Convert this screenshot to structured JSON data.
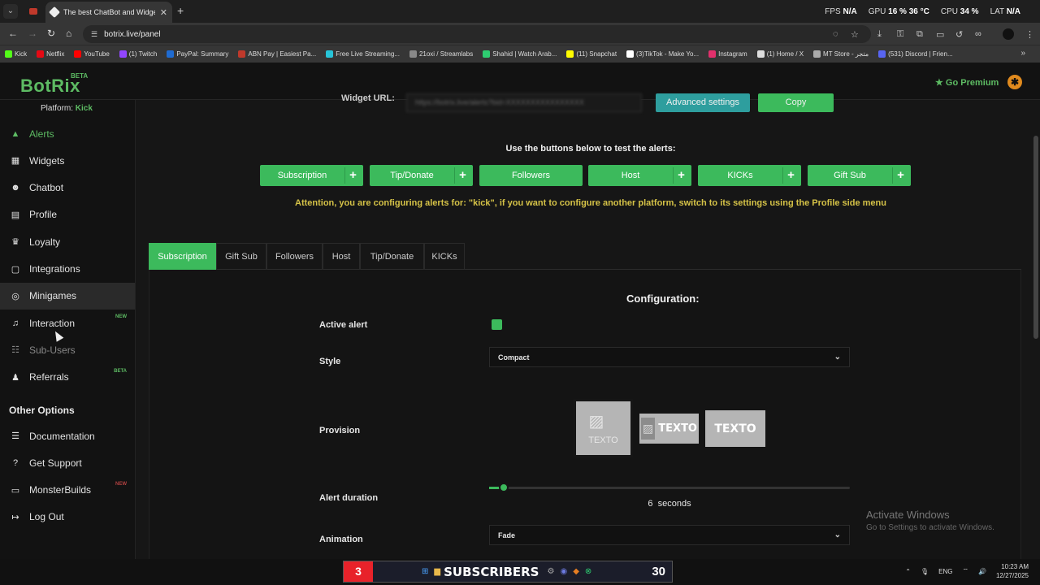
{
  "browser": {
    "tab_title": "The best ChatBot and Widgets",
    "new_tab_symbol": "+",
    "url": "botrix.live/panel",
    "sys_stats": [
      {
        "label": "FPS",
        "value": "N/A"
      },
      {
        "label": "GPU",
        "value": "16 % 36 °C"
      },
      {
        "label": "CPU",
        "value": "34 %"
      },
      {
        "label": "LAT",
        "value": "N/A"
      }
    ],
    "bookmarks": [
      {
        "label": "Kick",
        "color": "#53fc18"
      },
      {
        "label": "Netflix",
        "color": "#e50914"
      },
      {
        "label": "YouTube",
        "color": "#ff0000"
      },
      {
        "label": "(1) Twitch",
        "color": "#9146ff"
      },
      {
        "label": "PayPal: Summary",
        "color": "#1f6bd1"
      },
      {
        "label": "ABN Pay | Easiest Pa...",
        "color": "#c0392b"
      },
      {
        "label": "Free Live Streaming...",
        "color": "#27c4d8"
      },
      {
        "label": "21oxi / Streamlabs",
        "color": "#888888"
      },
      {
        "label": "Shahid | Watch Arab...",
        "color": "#2ecc71"
      },
      {
        "label": "(11) Snapchat",
        "color": "#fffc00"
      },
      {
        "label": "(3)TikTok - Make Yo...",
        "color": "#ffffff"
      },
      {
        "label": "Instagram",
        "color": "#e1306c"
      },
      {
        "label": "(1) Home / X",
        "color": "#dddddd"
      },
      {
        "label": "MT Store - متجر",
        "color": "#aaaaaa"
      },
      {
        "label": "(531) Discord | Frien...",
        "color": "#5865f2"
      }
    ]
  },
  "header": {
    "logo": "BotRix",
    "beta": "BETA",
    "premium": "Go Premium"
  },
  "sidebar": {
    "platform_label": "Platform:",
    "platform_value": "Kick",
    "items": [
      {
        "label": "Alerts",
        "icon": "warning-icon",
        "tag": ""
      },
      {
        "label": "Widgets",
        "icon": "grid-icon",
        "tag": ""
      },
      {
        "label": "Chatbot",
        "icon": "robot-icon",
        "tag": ""
      },
      {
        "label": "Profile",
        "icon": "id-card-icon",
        "tag": ""
      },
      {
        "label": "Loyalty",
        "icon": "trophy-icon",
        "tag": ""
      },
      {
        "label": "Integrations",
        "icon": "window-icon",
        "tag": ""
      },
      {
        "label": "Minigames",
        "icon": "gamepad-icon",
        "tag": ""
      },
      {
        "label": "Interaction",
        "icon": "music-icon",
        "tag": "NEW"
      },
      {
        "label": "Sub-Users",
        "icon": "users-icon",
        "tag": ""
      },
      {
        "label": "Referrals",
        "icon": "people-icon",
        "tag": "BETA"
      }
    ],
    "other_title": "Other Options",
    "other_items": [
      {
        "label": "Documentation",
        "icon": "list-icon",
        "tag": ""
      },
      {
        "label": "Get Support",
        "icon": "question-icon",
        "tag": ""
      },
      {
        "label": "MonsterBuilds",
        "icon": "laptop-icon",
        "tag": "NEW"
      },
      {
        "label": "Log Out",
        "icon": "logout-icon",
        "tag": ""
      }
    ]
  },
  "main": {
    "widget_url_label": "Widget URL:",
    "widget_url_value": "https://botrix.live/alerts?bid=XXXXXXXXXXXXXXXX",
    "advanced_label": "Advanced settings",
    "copy_label": "Copy",
    "test_label": "Use the buttons below to test the alerts:",
    "test_buttons": [
      "Subscription",
      "Tip/Donate",
      "Followers",
      "Host",
      "KICKs",
      "Gift Sub"
    ],
    "attention": "Attention, you are configuring alerts for: \"kick\", if you want to configure another platform, switch to its settings using the Profile side menu",
    "tabs": [
      "Subscription",
      "Gift Sub",
      "Followers",
      "Host",
      "Tip/Donate",
      "KICKs"
    ],
    "active_tab": "Subscription",
    "config_title": "Configuration:",
    "fields": {
      "active_label": "Active alert",
      "active_checked": true,
      "style_label": "Style",
      "style_value": "Compact",
      "provision_label": "Provision",
      "provision_text": "TEXTO",
      "duration_label": "Alert duration",
      "duration_value": "6",
      "duration_unit": "seconds",
      "duration_fraction": 0.04,
      "animation_label": "Animation",
      "animation_value": "Fade"
    },
    "activate_title": "Activate Windows",
    "activate_sub": "Go to Settings to activate Windows."
  },
  "taskbar": {
    "badge": "3",
    "subscribers": "SUBSCRIBERS",
    "count": "30",
    "lang": "ENG",
    "time": "10:23 AM",
    "date": "12/27/2025"
  }
}
